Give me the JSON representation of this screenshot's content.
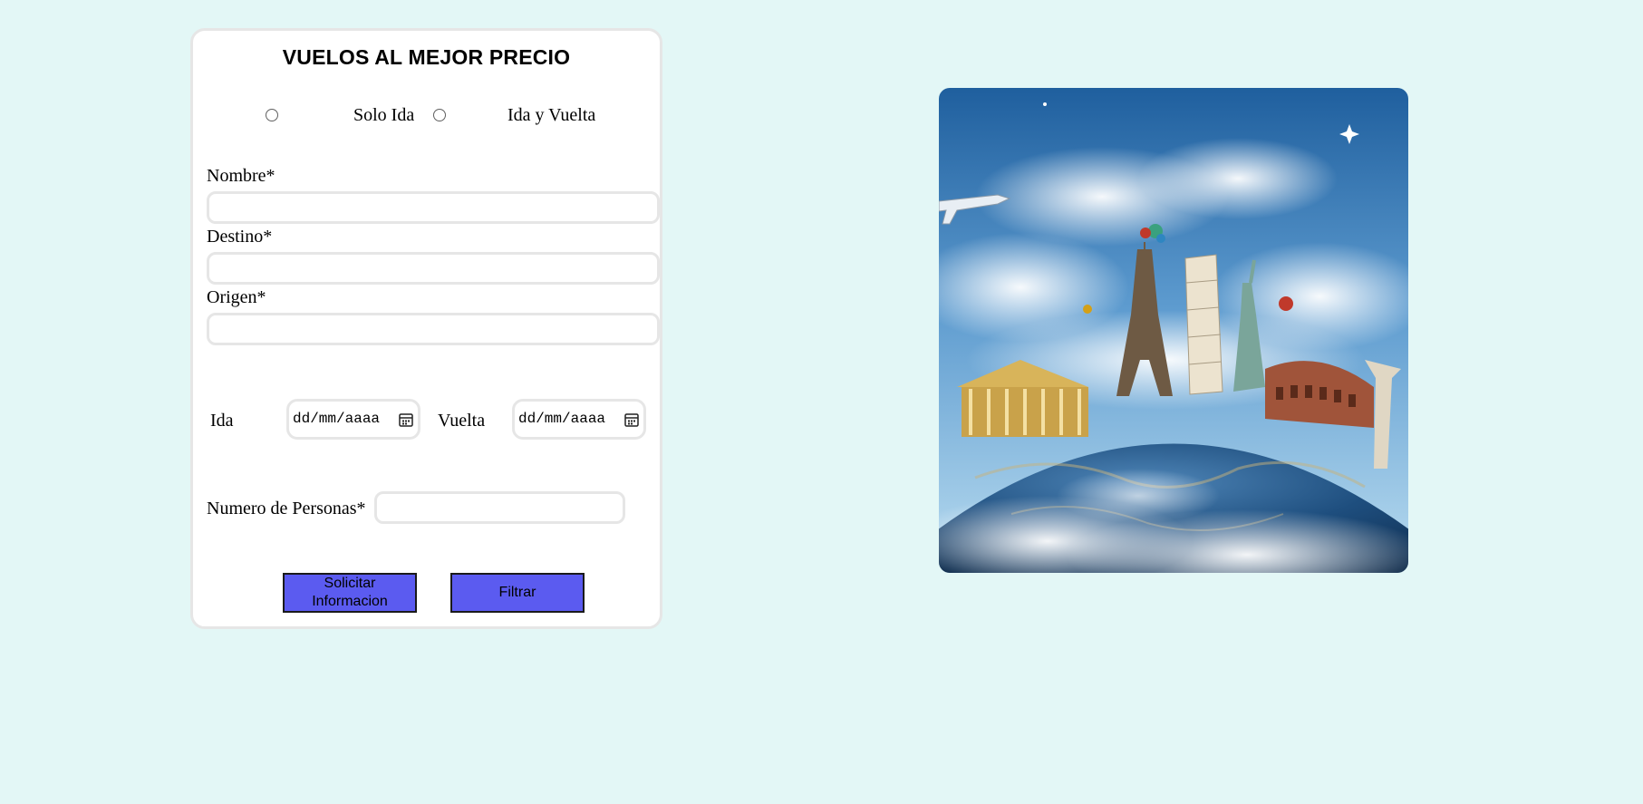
{
  "form": {
    "title": "VUELOS AL MEJOR PRECIO",
    "trip_options": [
      {
        "label": "Solo Ida",
        "selected": false
      },
      {
        "label": "Ida y Vuelta",
        "selected": false
      }
    ],
    "fields": {
      "nombre": {
        "label": "Nombre*",
        "value": ""
      },
      "destino": {
        "label": "Destino*",
        "value": ""
      },
      "origen": {
        "label": "Origen*",
        "value": ""
      }
    },
    "dates": {
      "ida": {
        "label": "Ida",
        "placeholder": "dd/mm/aaaa"
      },
      "vuelta": {
        "label": "Vuelta",
        "placeholder": "dd/mm/aaaa"
      }
    },
    "personas": {
      "label": "Numero de Personas*",
      "value": ""
    },
    "buttons": {
      "solicitar_line1": "Solicitar",
      "solicitar_line2": "Informacion",
      "filtrar": "Filtrar"
    }
  },
  "image": {
    "icon": "world-landmarks-globe-image"
  },
  "colors": {
    "page_background": "#e3f7f6",
    "card_background": "#ffffff",
    "button_fill": "#5b5bf0",
    "input_border": "#e6e6e6"
  }
}
